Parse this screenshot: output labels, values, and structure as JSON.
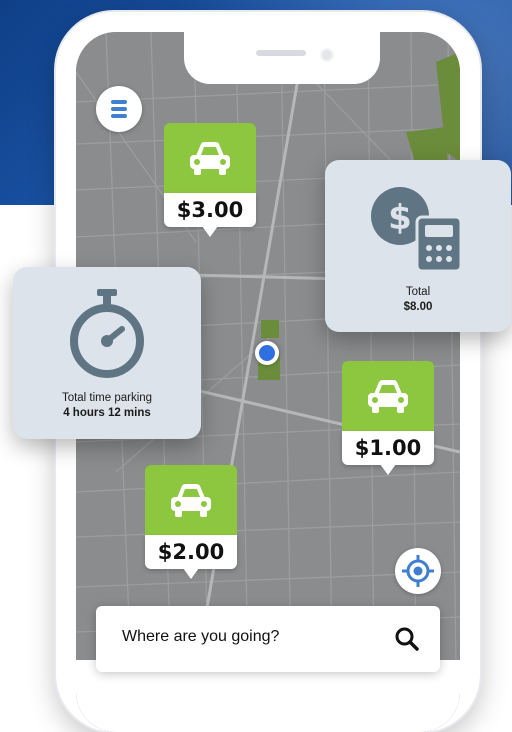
{
  "markers": [
    {
      "price": "$3.00",
      "icon": "car-icon"
    },
    {
      "price": "$1.00",
      "icon": "car-icon"
    },
    {
      "price": "$2.00",
      "icon": "car-icon"
    }
  ],
  "total_card": {
    "label": "Total",
    "value": "$8.00",
    "icon": "dollar-calculator-icon"
  },
  "time_card": {
    "label": "Total time parking",
    "value": "4 hours 12 mins",
    "icon": "stopwatch-icon"
  },
  "search": {
    "placeholder": "Where are you going?",
    "icon": "search-icon"
  },
  "controls": {
    "menu_icon": "hamburger-menu-icon",
    "locate_icon": "crosshair-icon"
  },
  "colors": {
    "accent_green": "#8dc63f",
    "accent_blue": "#3f7fcf",
    "card_gray": "#dde3ea",
    "icon_slate": "#5f7584",
    "map_gray": "#8a8c8d",
    "banner_blue": "#1d5ab0"
  }
}
